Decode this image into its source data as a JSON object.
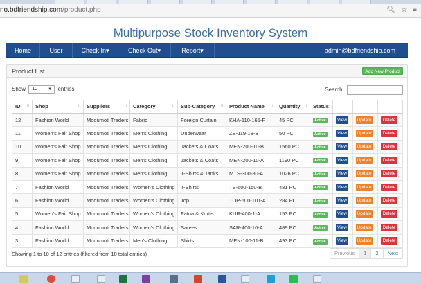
{
  "browser": {
    "url_host": "no.bdfriendship.com",
    "url_path": "/product.php"
  },
  "app": {
    "title": "Multipurpose Stock Inventory System"
  },
  "nav": {
    "items": [
      "Home",
      "User",
      "Check In▾",
      "Check Out▾",
      "Report▾"
    ],
    "user": "admin@bdfriendship.com"
  },
  "panel": {
    "title": "Product List",
    "add_label": "Add New Product"
  },
  "controls": {
    "show_label": "Show",
    "entries_value": "10",
    "entries_label": "entries",
    "search_label": "Search:"
  },
  "table": {
    "headers": [
      "ID",
      "Shop",
      "Suppliers",
      "Category",
      "Sub-Category",
      "Product Name",
      "Quantity",
      "Status",
      "",
      "",
      ""
    ],
    "rows": [
      [
        "12",
        "Fashion World",
        "Modumoti Traders",
        "Fabric",
        "Foreign Curtain",
        "KHA-110-165-F",
        "45 PC"
      ],
      [
        "11",
        "Women's Fair Shop",
        "Modumoti Traders",
        "Men's Clothing",
        "Underwear",
        "ZE-119-18-B",
        "50 PC"
      ],
      [
        "10",
        "Women's Fair Shop",
        "Modumoti Traders",
        "Men's Clothing",
        "Jackets & Coats",
        "MEN-200-10-B",
        "1560 PC"
      ],
      [
        "9",
        "Women's Fair Shop",
        "Modumoti Traders",
        "Men's Clothing",
        "Jackets & Coats",
        "MEN-200-10-A",
        "1190 PC"
      ],
      [
        "8",
        "Women's Fair Shop",
        "Modumoti Traders",
        "Men's Clothing",
        "T-Shirts & Tanks",
        "MTS-300-80-A",
        "1026 PC"
      ],
      [
        "7",
        "Fashion World",
        "Modumoti Traders",
        "Women's Clothing",
        "T-Shirts",
        "TS-600-150-B",
        "481 PC"
      ],
      [
        "6",
        "Fashion World",
        "Modumoti Traders",
        "Women's Clothing",
        "Top",
        "TOP-600-101-A",
        "284 PC"
      ],
      [
        "5",
        "Women's Fair Shop",
        "Modumoti Traders",
        "Women's Clothing",
        "Fatua & Kurtis",
        "KUR-400-1-A",
        "153 PC"
      ],
      [
        "4",
        "Fashion World",
        "Modumoti Traders",
        "Women's Clothing",
        "Sarees",
        "SAR-400-10-A",
        "489 PC"
      ],
      [
        "3",
        "Fashion World",
        "Modumoti Traders",
        "Men's Clothing",
        "Shirts",
        "MEN-100-11-B",
        "493 PC"
      ]
    ],
    "status": "Active",
    "view_label": "View",
    "update_label": "Update",
    "delete_label": "Delete"
  },
  "footer": {
    "info": "Showing 1 to 10 of 12 entries (filtered from 10 total entries)",
    "pages": [
      "Previous",
      "1",
      "2",
      "Next"
    ]
  },
  "colors": {
    "nav": "#1f4f8e",
    "title": "#3b6ea5",
    "active": "#5cb85c",
    "update": "#f0812b",
    "delete": "#d9353b"
  }
}
